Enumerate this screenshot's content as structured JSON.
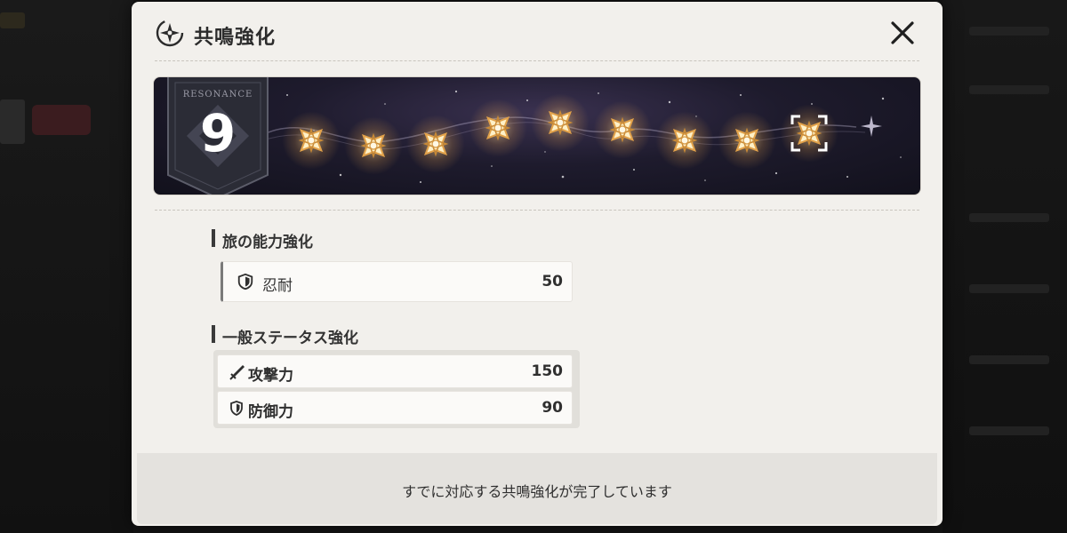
{
  "window": {
    "title": "共鳴強化",
    "title_icon": "resonance-compass-icon",
    "close_icon": "close-icon"
  },
  "resonance": {
    "label": "RESONANCE",
    "level": "9",
    "nodes_activated": 8,
    "nodes_total": 9,
    "selected_node": 9
  },
  "travel_section": {
    "title": "旅の能力強化",
    "rows": [
      {
        "label": "忍耐",
        "value": "50",
        "icon": "shield-icon"
      }
    ]
  },
  "stats_section": {
    "title": "一般ステータス強化",
    "rows": [
      {
        "label": "攻撃力",
        "value": "150",
        "icon": "sword-icon"
      },
      {
        "label": "防御力",
        "value": "90",
        "icon": "shield-icon"
      }
    ]
  },
  "footer": {
    "message": "すでに対応する共鳴強化が完了しています"
  },
  "colors": {
    "panel_bg": "#f2f0ec",
    "banner_bg": "#1e1b2d",
    "node_glow": "#ffd68c",
    "text": "#2f2f2f"
  }
}
